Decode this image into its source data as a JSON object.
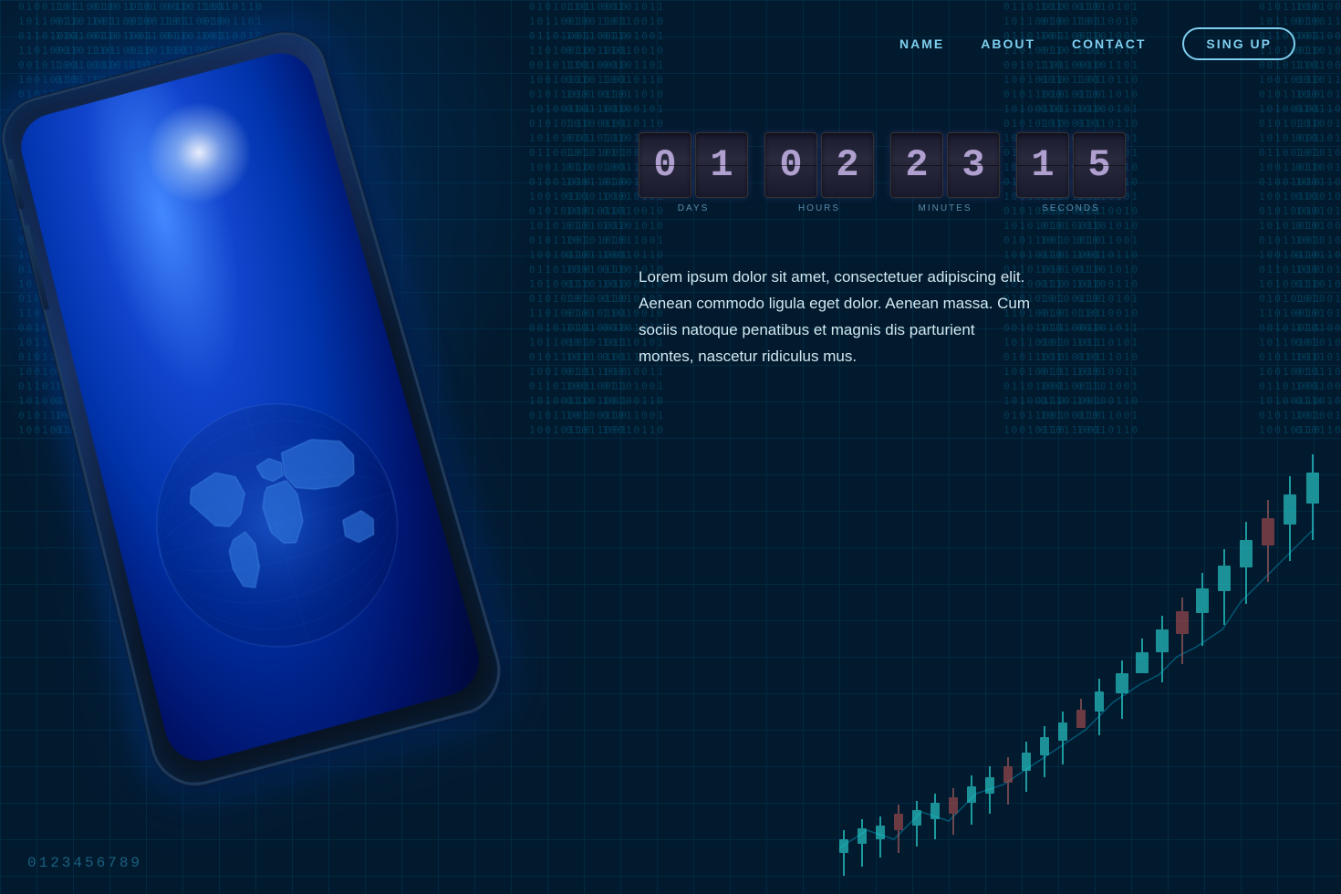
{
  "nav": {
    "links": [
      {
        "label": "NAME",
        "id": "nav-name"
      },
      {
        "label": "ABOUT",
        "id": "nav-about"
      },
      {
        "label": "CONTACT",
        "id": "nav-contact"
      }
    ],
    "signup_label": "SING UP"
  },
  "countdown": {
    "days": {
      "digits": [
        "0",
        "1"
      ],
      "label": "DAYS"
    },
    "hours": {
      "digits": [
        "0",
        "2"
      ],
      "label": "HOURS"
    },
    "minutes": {
      "digits": [
        "2",
        "3"
      ],
      "label": "MINUTES"
    },
    "seconds": {
      "digits": [
        "1",
        "5"
      ],
      "label": "SECONDS"
    }
  },
  "body_text": "Lorem ipsum dolor sit amet, consectetuer adipiscing elit. Aenean commodo ligula eget dolor. Aenean massa. Cum sociis natoque penatibus et magnis dis parturient montes, nascetur ridiculus mus.",
  "bottom_numbers": "0123456789",
  "colors": {
    "background": "#021a2e",
    "accent": "#00ccff",
    "nav_text": "#7ecfef",
    "body_text": "#d0e8f0",
    "digit_color": "#b0a0d0",
    "label_color": "#5a8aaa"
  }
}
